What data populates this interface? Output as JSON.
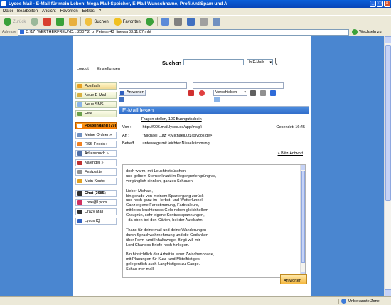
{
  "window": {
    "title": "Lycos Mail - E-Mail für mein Leben: Mega Mail-Speicher, E-Mail Wunschname, Profi AntiSpam und A",
    "controls": [
      "_",
      "□",
      "×"
    ]
  },
  "menu": [
    "Datei",
    "Bearbeiten",
    "Ansicht",
    "Favoriten",
    "Extras",
    "?"
  ],
  "toolbar": {
    "back": "Zurück",
    "search": "Suchen",
    "favorites": "Favoriten"
  },
  "addressbar": {
    "label": "Adresse",
    "url": "C:\\17_WERTHERFREUND....2007\\2_b_Peterari43_linewar03.11.07.mht",
    "go_label": "Wechseln zu"
  },
  "lycos": {
    "search_label": "Suchen",
    "search_value": "",
    "search_scope": "In E-Mails",
    "logout": "Logout",
    "settings": "Einstellungen"
  },
  "sidebar": {
    "items": [
      {
        "label": "Postfach",
        "style": "yellow",
        "color": "#e8a020"
      },
      {
        "label": "Neue E-Mail",
        "style": "green",
        "color": "#d8b040"
      },
      {
        "label": "Neue SMS",
        "style": "green",
        "color": "#8ab4e8"
      },
      {
        "label": "Hilfe",
        "style": "green",
        "color": "#6aa04a"
      },
      {
        "label": "Posteingang (79)",
        "style": "active",
        "color": "#ffffff"
      },
      {
        "label": "Meine Ordner »",
        "style": "plain",
        "color": "#7090c0",
        "chev": "›"
      },
      {
        "label": "RSS Feeds  »",
        "style": "plain",
        "color": "#f08020",
        "chev": "›"
      },
      {
        "label": "Adressbuch  »",
        "style": "plain",
        "color": "#5070a8",
        "chev": "›"
      },
      {
        "label": "Kalender  »",
        "style": "plain",
        "color": "#c03030",
        "chev": "›"
      },
      {
        "label": "Festplatte",
        "style": "plain",
        "color": "#909090"
      },
      {
        "label": "Mein Konto",
        "style": "plain",
        "color": "#e0a020"
      },
      {
        "label": "Chat (3685)",
        "style": "plain",
        "color": "#303030"
      },
      {
        "label": "Love@Lycos",
        "style": "plain",
        "color": "#d03060"
      },
      {
        "label": "Crazy Mail",
        "style": "plain",
        "color": "#303030"
      },
      {
        "label": "Lycos IQ",
        "style": "plain",
        "color": "#3060c0"
      }
    ]
  },
  "actions": {
    "reply": "Antworten",
    "move": "Verschieben",
    "reply_bottom": "Antworten"
  },
  "mail": {
    "panel_title": "E-Mail lesen",
    "ad_link": "Fragen stellen, 10€ Buchgutschein",
    "from_label": "Von :",
    "from_value": "http://f006.mail.lycos.de/app/msg/i",
    "sent_label": "Gesendet: 16:45",
    "to_label": "An :",
    "to_value": "\"Michael Lutz\" <MichaelLutz@lycos.de>",
    "subject_label": "Betreff",
    "subject_value": "unterwegs mit leichter Nieselstimmung,",
    "quick_reply": "» Blitz-Antwort",
    "body_paragraphs": [
      [
        "doch warm, mit Leuchtrotbüschen",
        "und gelbem Sternenkraut im Regenperlengrüngras,",
        "vergänglich-sinnlich, ganzes Schauen."
      ],
      [
        "Lieber Michael,",
        "bin gerade von meinem Spaziergang zurück",
        "und noch ganz im Herbst- und Wetterlunnel.",
        "Ganz eigene Farbstimmung, Farbvaleurs,",
        "mittleres leuchtendes Gelb neben gleichhellem",
        "Graugrün, sehr eigene Kontrastspannungen,",
        "- da oben bei den Gärten, bei der Autobahn."
      ],
      [
        "Thanx für deine mail und deine Wanderungen",
        "durch Sprachwahrnehmung und die Gedanken",
        "über Form- und Inhaltswege, Birgit will mir",
        "Lord Chandos Briefe noch hinlegen."
      ],
      [
        "Bin hinsichtlich der Arbeit in einer Zwischenphase,",
        "mit Planungen für Kurz- und Mittelfristiges,",
        "gelegentlich auch Langfristiges zu Gange.",
        "Schau mer mall"
      ]
    ]
  },
  "statusbar": {
    "zone": "Unbekannte Zone"
  }
}
